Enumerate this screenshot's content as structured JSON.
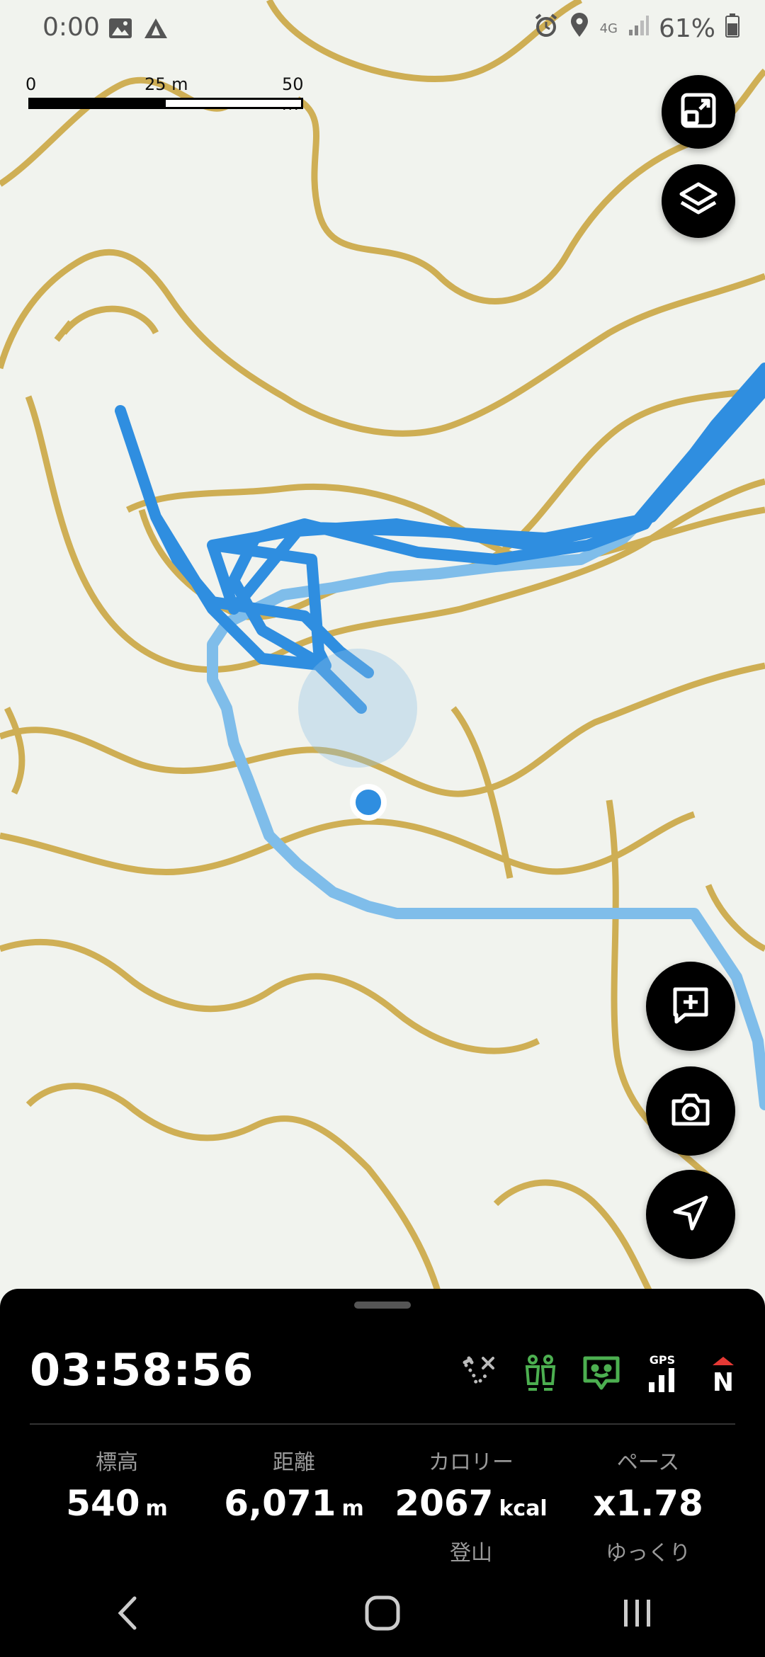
{
  "status_bar": {
    "time": "0:00",
    "network": "4G",
    "battery": "61%",
    "icons": [
      "image-icon",
      "triangle-app-icon",
      "alarm-icon",
      "location-icon",
      "signal-icon",
      "battery-icon"
    ]
  },
  "scale_bar": {
    "label_0": "0",
    "label_mid": "25 m",
    "label_end": "50 m"
  },
  "map_buttons": [
    {
      "name": "resize-icon"
    },
    {
      "name": "layers-icon"
    },
    {
      "name": "add-note-icon"
    },
    {
      "name": "camera-icon"
    },
    {
      "name": "navigation-icon"
    }
  ],
  "panel": {
    "elapsed_time": "03:58:56",
    "status_icons": [
      "route-off-icon",
      "climbers-icon",
      "chat-icon",
      "gps-signal-icon",
      "compass-north-icon"
    ],
    "gps_label": "GPS",
    "north_label": "N",
    "stats": [
      {
        "label": "標高",
        "value": "540",
        "unit": "m",
        "sub": ""
      },
      {
        "label": "距離",
        "value": "6,071",
        "unit": "m",
        "sub": ""
      },
      {
        "label": "カロリー",
        "value": "2067",
        "unit": "kcal",
        "sub": "登山"
      },
      {
        "label": "ペース",
        "value": "x1.78",
        "unit": "",
        "sub": "ゆっくり"
      }
    ]
  },
  "colors": {
    "contour": "#c9a23a",
    "track": "#2f8ee0",
    "planned_route": "#7fbdea",
    "map_bg": "#f1f3ee",
    "panel_bg": "#000000",
    "active_green": "#4caf50"
  },
  "navigation_bar": [
    "back-icon",
    "home-icon",
    "recents-icon"
  ]
}
